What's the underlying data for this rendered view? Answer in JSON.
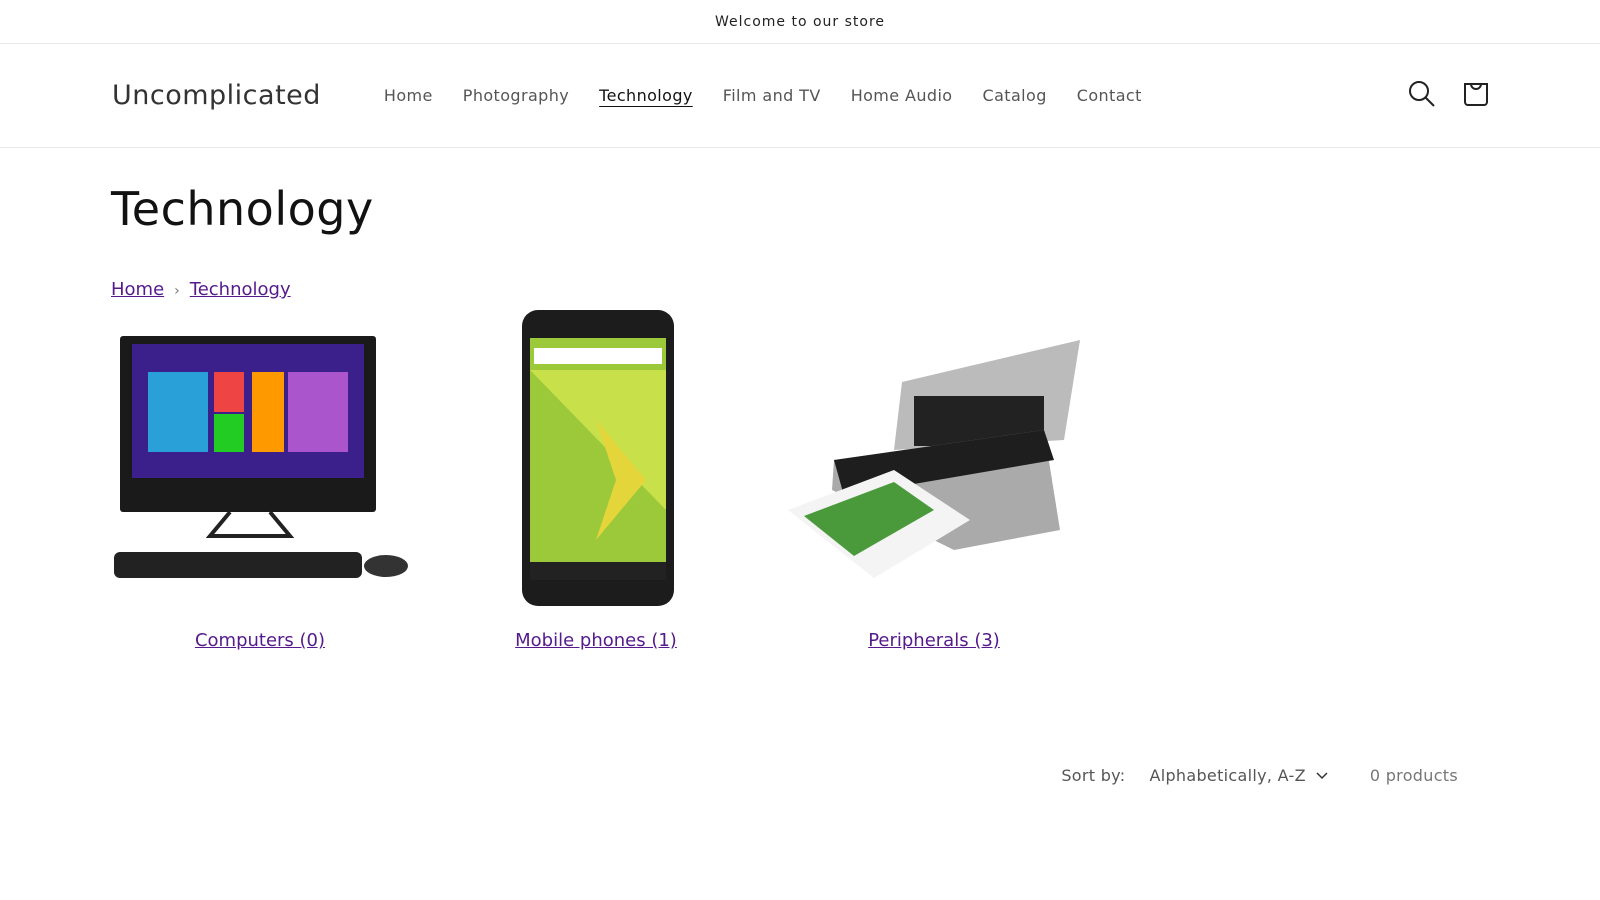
{
  "announcement": "Welcome to our store",
  "header": {
    "logo": "Uncomplicated",
    "nav": [
      {
        "label": "Home"
      },
      {
        "label": "Photography"
      },
      {
        "label": "Technology",
        "active": true
      },
      {
        "label": "Film and TV"
      },
      {
        "label": "Home Audio"
      },
      {
        "label": "Catalog"
      },
      {
        "label": "Contact"
      }
    ],
    "icons": [
      "search-icon",
      "cart-icon"
    ]
  },
  "page": {
    "title": "Technology",
    "breadcrumb": [
      {
        "label": "Home"
      },
      {
        "label": "Technology"
      }
    ]
  },
  "collections": [
    {
      "label": "Computers (0)",
      "image": "all-in-one-computer"
    },
    {
      "label": "Mobile phones (1)",
      "image": "smartphone"
    },
    {
      "label": "Peripherals (3)",
      "image": "printer"
    }
  ],
  "sort": {
    "label": "Sort by:",
    "value": "Alphabetically, A-Z",
    "count": "0 products"
  },
  "colors": {
    "link": "#551a8b",
    "text": "#121212"
  }
}
